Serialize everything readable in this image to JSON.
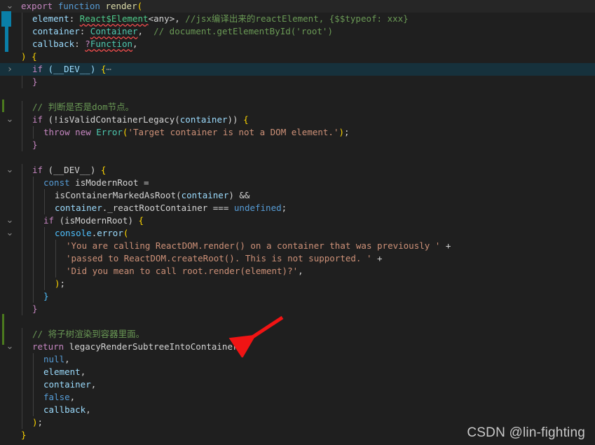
{
  "editor": {
    "theme_background": "#1f1f1f",
    "current_line_background": "#262626",
    "folded_line_background": "#16313c",
    "font_size_px": 12.5,
    "line_height_px": 18
  },
  "gutter": {
    "fold_open_icon": "chevron-down-icon",
    "fold_closed_icon": "chevron-right-icon",
    "change_marker_color": "#4b7a1e",
    "selection_marker_color": "#0a7fa8"
  },
  "code": {
    "language": "javascript",
    "lines": [
      {
        "n": 1,
        "indent": 0,
        "fold": "open",
        "state": "current",
        "tokens": [
          {
            "t": "export",
            "c": "kw"
          },
          {
            "t": " ",
            "c": "plain"
          },
          {
            "t": "function",
            "c": "kw2"
          },
          {
            "t": " ",
            "c": "plain"
          },
          {
            "t": "render",
            "c": "fn"
          },
          {
            "t": "(",
            "c": "yellow"
          }
        ]
      },
      {
        "n": 2,
        "indent": 1,
        "tokens": [
          {
            "t": "element",
            "c": "ident"
          },
          {
            "t": ": ",
            "c": "plain"
          },
          {
            "t": "React$Element",
            "c": "type2",
            "squiggle": true
          },
          {
            "t": "<any>",
            "c": "plain"
          },
          {
            "t": ", ",
            "c": "plain"
          },
          {
            "t": "//jsx编译出来的reactElement, {$$typeof: xxx}",
            "c": "cmt"
          }
        ]
      },
      {
        "n": 3,
        "indent": 1,
        "tokens": [
          {
            "t": "container",
            "c": "ident"
          },
          {
            "t": ": ",
            "c": "plain"
          },
          {
            "t": "Container",
            "c": "type",
            "squiggle": true
          },
          {
            "t": ",  ",
            "c": "plain"
          },
          {
            "t": "// document.getElementById('root')",
            "c": "cmt"
          }
        ]
      },
      {
        "n": 4,
        "indent": 1,
        "tokens": [
          {
            "t": "callback",
            "c": "ident"
          },
          {
            "t": ": ",
            "c": "plain"
          },
          {
            "t": "?",
            "c": "pink",
            "squiggle": true
          },
          {
            "t": "Function",
            "c": "type",
            "squiggle": true
          },
          {
            "t": ",",
            "c": "plain"
          }
        ]
      },
      {
        "n": 5,
        "indent": 0,
        "tokens": [
          {
            "t": ")",
            "c": "yellow"
          },
          {
            "t": " ",
            "c": "plain"
          },
          {
            "t": "{",
            "c": "yellow"
          }
        ]
      },
      {
        "n": 6,
        "indent": 1,
        "fold": "closed",
        "state": "folded",
        "tokens": [
          {
            "t": "if",
            "c": "pink"
          },
          {
            "t": " ",
            "c": "plain"
          },
          {
            "t": "(",
            "c": "ident"
          },
          {
            "t": "__DEV__",
            "c": "ident"
          },
          {
            "t": ")",
            "c": "ident"
          },
          {
            "t": " ",
            "c": "plain"
          },
          {
            "t": "{",
            "c": "yellow"
          },
          {
            "t": "⋯",
            "c": "dots"
          }
        ]
      },
      {
        "n": 7,
        "indent": 1,
        "tokens": [
          {
            "t": "}",
            "c": "pink"
          }
        ]
      },
      {
        "n": 8,
        "indent": 0,
        "tokens": []
      },
      {
        "n": 9,
        "indent": 1,
        "tokens": [
          {
            "t": "// 判断是否是dom节点。",
            "c": "cmt"
          }
        ]
      },
      {
        "n": 10,
        "indent": 1,
        "fold": "open",
        "tokens": [
          {
            "t": "if",
            "c": "pink"
          },
          {
            "t": " ",
            "c": "plain"
          },
          {
            "t": "(!",
            "c": "plain"
          },
          {
            "t": "isValidContainerLegacy",
            "c": "plain"
          },
          {
            "t": "(",
            "c": "plain"
          },
          {
            "t": "container",
            "c": "ident"
          },
          {
            "t": ")) ",
            "c": "plain"
          },
          {
            "t": "{",
            "c": "yellow"
          }
        ]
      },
      {
        "n": 11,
        "indent": 2,
        "tokens": [
          {
            "t": "throw",
            "c": "pink"
          },
          {
            "t": " ",
            "c": "plain"
          },
          {
            "t": "new",
            "c": "pink"
          },
          {
            "t": " ",
            "c": "plain"
          },
          {
            "t": "Error",
            "c": "type"
          },
          {
            "t": "(",
            "c": "yellow"
          },
          {
            "t": "'Target container is not a DOM element.'",
            "c": "str"
          },
          {
            "t": ")",
            "c": "yellow"
          },
          {
            "t": ";",
            "c": "plain"
          }
        ]
      },
      {
        "n": 12,
        "indent": 1,
        "tokens": [
          {
            "t": "}",
            "c": "pink"
          }
        ]
      },
      {
        "n": 13,
        "indent": 0,
        "tokens": []
      },
      {
        "n": 14,
        "indent": 1,
        "fold": "open",
        "tokens": [
          {
            "t": "if",
            "c": "pink"
          },
          {
            "t": " ",
            "c": "plain"
          },
          {
            "t": "(",
            "c": "plain"
          },
          {
            "t": "__DEV__",
            "c": "plain"
          },
          {
            "t": ") ",
            "c": "plain"
          },
          {
            "t": "{",
            "c": "yellow"
          }
        ]
      },
      {
        "n": 15,
        "indent": 2,
        "tokens": [
          {
            "t": "const",
            "c": "kw2"
          },
          {
            "t": " ",
            "c": "plain"
          },
          {
            "t": "isModernRoot",
            "c": "plain"
          },
          {
            "t": " =",
            "c": "plain"
          }
        ]
      },
      {
        "n": 16,
        "indent": 3,
        "tokens": [
          {
            "t": "isContainerMarkedAsRoot",
            "c": "plain"
          },
          {
            "t": "(",
            "c": "plain"
          },
          {
            "t": "container",
            "c": "ident"
          },
          {
            "t": ") &&",
            "c": "plain"
          }
        ]
      },
      {
        "n": 17,
        "indent": 3,
        "tokens": [
          {
            "t": "container",
            "c": "ident"
          },
          {
            "t": "._reactRootContainer",
            "c": "plain"
          },
          {
            "t": " === ",
            "c": "plain"
          },
          {
            "t": "undefined",
            "c": "kw2"
          },
          {
            "t": ";",
            "c": "plain"
          }
        ]
      },
      {
        "n": 18,
        "indent": 2,
        "fold": "open",
        "tokens": [
          {
            "t": "if",
            "c": "pink"
          },
          {
            "t": " ",
            "c": "plain"
          },
          {
            "t": "(",
            "c": "plain"
          },
          {
            "t": "isModernRoot",
            "c": "plain"
          },
          {
            "t": ") ",
            "c": "plain"
          },
          {
            "t": "{",
            "c": "yellow"
          }
        ]
      },
      {
        "n": 19,
        "indent": 3,
        "fold": "open",
        "tokens": [
          {
            "t": "console",
            "c": "obj"
          },
          {
            "t": ".",
            "c": "plain"
          },
          {
            "t": "error",
            "c": "ident"
          },
          {
            "t": "(",
            "c": "yellow"
          }
        ]
      },
      {
        "n": 20,
        "indent": 4,
        "tokens": [
          {
            "t": "'You are calling ReactDOM.render() on a container that was previously '",
            "c": "str"
          },
          {
            "t": " +",
            "c": "plain"
          }
        ]
      },
      {
        "n": 21,
        "indent": 4,
        "tokens": [
          {
            "t": "'passed to ReactDOM.createRoot(). This is not supported. '",
            "c": "str"
          },
          {
            "t": " +",
            "c": "plain"
          }
        ]
      },
      {
        "n": 22,
        "indent": 4,
        "tokens": [
          {
            "t": "'Did you mean to call root.render(element)?'",
            "c": "str"
          },
          {
            "t": ",",
            "c": "plain"
          }
        ]
      },
      {
        "n": 23,
        "indent": 3,
        "tokens": [
          {
            "t": ")",
            "c": "yellow"
          },
          {
            "t": ";",
            "c": "plain"
          }
        ]
      },
      {
        "n": 24,
        "indent": 2,
        "tokens": [
          {
            "t": "}",
            "c": "obj"
          }
        ]
      },
      {
        "n": 25,
        "indent": 1,
        "tokens": [
          {
            "t": "}",
            "c": "pink"
          }
        ]
      },
      {
        "n": 26,
        "indent": 0,
        "tokens": []
      },
      {
        "n": 27,
        "indent": 1,
        "tokens": [
          {
            "t": "// 将子树渲染到容器里面。",
            "c": "cmt"
          }
        ]
      },
      {
        "n": 28,
        "indent": 1,
        "fold": "open",
        "tokens": [
          {
            "t": "return",
            "c": "pink"
          },
          {
            "t": " ",
            "c": "plain"
          },
          {
            "t": "legacyRenderSubtreeIntoContainer",
            "c": "plain"
          },
          {
            "t": "(",
            "c": "yellow"
          }
        ]
      },
      {
        "n": 29,
        "indent": 2,
        "tokens": [
          {
            "t": "null",
            "c": "kw2"
          },
          {
            "t": ",",
            "c": "plain"
          }
        ]
      },
      {
        "n": 30,
        "indent": 2,
        "tokens": [
          {
            "t": "element",
            "c": "ident"
          },
          {
            "t": ",",
            "c": "plain"
          }
        ]
      },
      {
        "n": 31,
        "indent": 2,
        "tokens": [
          {
            "t": "container",
            "c": "ident"
          },
          {
            "t": ",",
            "c": "plain"
          }
        ]
      },
      {
        "n": 32,
        "indent": 2,
        "tokens": [
          {
            "t": "false",
            "c": "kw2"
          },
          {
            "t": ",",
            "c": "plain"
          }
        ]
      },
      {
        "n": 33,
        "indent": 2,
        "tokens": [
          {
            "t": "callback",
            "c": "ident"
          },
          {
            "t": ",",
            "c": "plain"
          }
        ]
      },
      {
        "n": 34,
        "indent": 1,
        "tokens": [
          {
            "t": ")",
            "c": "yellow"
          },
          {
            "t": ";",
            "c": "plain"
          }
        ]
      },
      {
        "n": 35,
        "indent": 0,
        "tokens": [
          {
            "t": "}",
            "c": "yellow"
          }
        ]
      }
    ]
  },
  "annotation": {
    "arrow_color": "#f01414",
    "arrow_label": "points-to-legacyRenderSubtreeIntoContainer"
  },
  "watermark": {
    "text": "CSDN @lin-fighting"
  }
}
